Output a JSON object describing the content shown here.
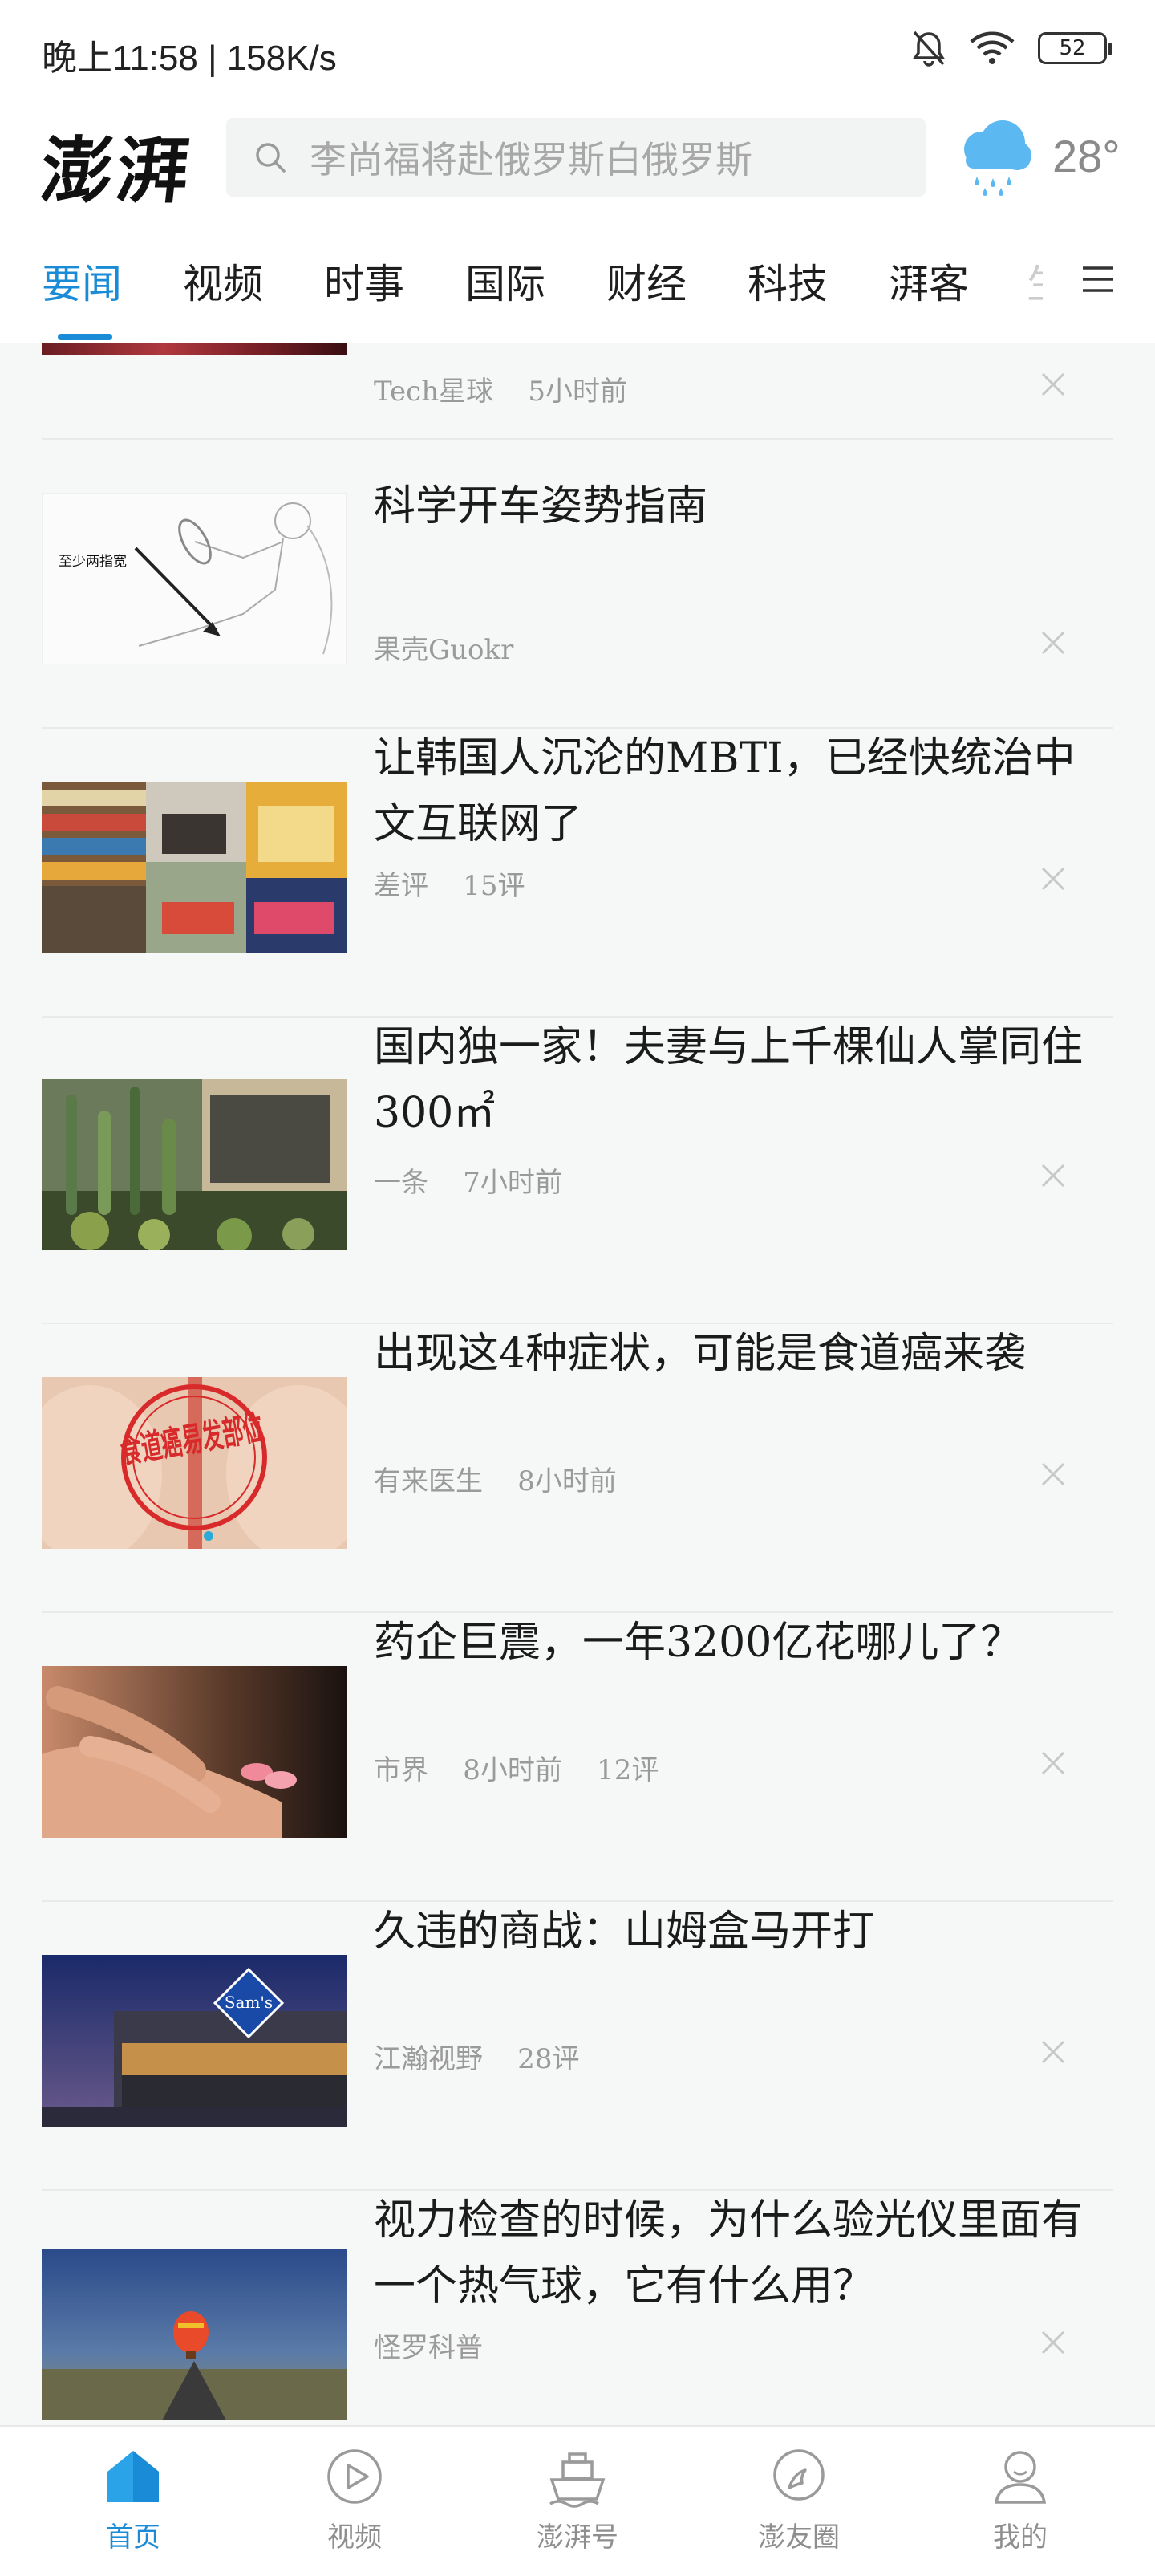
{
  "status_bar": {
    "time_speed": "晚上11:58 | 158K/s",
    "battery": "52"
  },
  "header": {
    "logo_text": "澎湃",
    "search_placeholder": "李尚福将赴俄罗斯白俄罗斯",
    "temperature": "28°"
  },
  "tabs": [
    "要闻",
    "视频",
    "时事",
    "国际",
    "财经",
    "科技",
    "湃客"
  ],
  "tab_partial": "生",
  "articles": [
    {
      "title": "",
      "source": "Tech星球",
      "time": "5小时前",
      "comments": ""
    },
    {
      "title": "科学开车姿势指南",
      "source": "果壳Guokr",
      "time": "",
      "comments": "",
      "thumb_caption": "至少两指宽"
    },
    {
      "title": "让韩国人沉沦的MBTI，已经快统治中文互联网了",
      "source": "差评",
      "time": "",
      "comments": "15评"
    },
    {
      "title": "国内独一家！夫妻与上千棵仙人掌同住300㎡",
      "source": "一条",
      "time": "7小时前",
      "comments": ""
    },
    {
      "title": "出现这4种症状，可能是食道癌来袭",
      "source": "有来医生",
      "time": "8小时前",
      "comments": "",
      "thumb_caption": "食道癌易发部位"
    },
    {
      "title": "药企巨震，一年3200亿花哪儿了？",
      "source": "市界",
      "time": "8小时前",
      "comments": "12评"
    },
    {
      "title": "久违的商战：山姆盒马开打",
      "source": "江瀚视野",
      "time": "",
      "comments": "28评",
      "thumb_caption": "Sam's"
    },
    {
      "title": "视力检查的时候，为什么验光仪里面有一个热气球，它有什么用？",
      "source": "怪罗科普",
      "time": "",
      "comments": ""
    }
  ],
  "bottom_nav": [
    "首页",
    "视频",
    "澎湃号",
    "澎友圈",
    "我的"
  ],
  "colors": {
    "accent": "#1a8bd6",
    "meta": "#9a9a9a",
    "background": "#f6f7f7"
  }
}
